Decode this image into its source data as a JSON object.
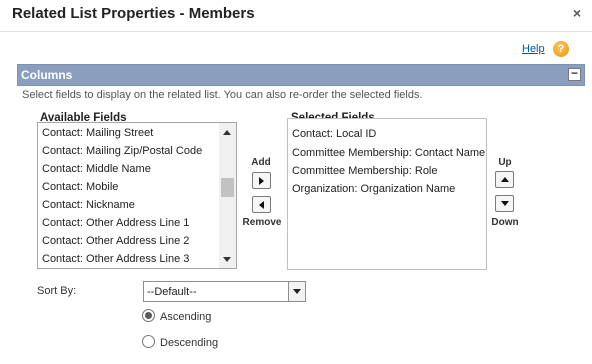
{
  "dialog": {
    "title": "Related List Properties - Members",
    "close_glyph": "×"
  },
  "help": {
    "label": "Help",
    "icon_glyph": "?"
  },
  "columns_section": {
    "title": "Columns",
    "collapse_glyph": "−",
    "instructions": "Select fields to display on the related list. You can also re-order the selected fields."
  },
  "available_fields": {
    "label": "Available Fields",
    "items": [
      "Contact: Mailing Street",
      "Contact: Mailing Zip/Postal Code",
      "Contact: Middle Name",
      "Contact: Mobile",
      "Contact: Nickname",
      "Contact: Other Address Line 1",
      "Contact: Other Address Line 2",
      "Contact: Other Address Line 3"
    ]
  },
  "selected_fields": {
    "label": "Selected Fields",
    "items": [
      "Contact: Local ID",
      "Committee Membership: Contact Name",
      "Committee Membership: Role",
      "Organization: Organization Name"
    ]
  },
  "controls": {
    "add_label": "Add",
    "remove_label": "Remove",
    "up_label": "Up",
    "down_label": "Down"
  },
  "sort": {
    "label": "Sort By:",
    "selected_value": "--Default--",
    "ascending_label": "Ascending",
    "descending_label": "Descending",
    "order": "Ascending"
  },
  "colors": {
    "section_bar": "#8a9ebe",
    "link": "#015ba7",
    "help_icon": "#e8960c"
  }
}
